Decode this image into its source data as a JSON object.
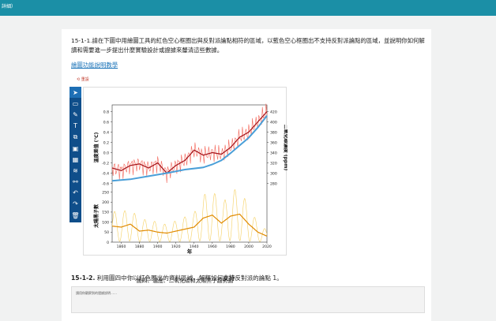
{
  "header": {
    "title": "詳細）"
  },
  "question1": {
    "number": "15-1-1.",
    "text": "請在下圖中用繪圖工具的紅色空心框圈出與反對派論點相符的區域，以藍色空心框圈出不支持反對派論點的區域，並說明你如何解讀和需要進一步提出什麼實驗設計或證據來釐清這些數據。",
    "tutorial_link": "繪圖功能說明教學",
    "undo_label": "重設"
  },
  "toolbar": {
    "tools": [
      {
        "icon": "cursor-icon",
        "glyph": "➤"
      },
      {
        "icon": "rectangle-icon",
        "glyph": "▭"
      },
      {
        "icon": "pencil-icon",
        "glyph": "✎"
      },
      {
        "icon": "text-icon",
        "glyph": "T"
      },
      {
        "icon": "image-icon",
        "glyph": "⧉"
      },
      {
        "icon": "frame-icon",
        "glyph": "▣"
      },
      {
        "icon": "color-palette-icon",
        "glyph": "▦"
      },
      {
        "icon": "layers-icon",
        "glyph": "≋"
      },
      {
        "icon": "link-icon",
        "glyph": "⚯"
      },
      {
        "icon": "undo-icon",
        "glyph": "↶"
      },
      {
        "icon": "redo-icon",
        "glyph": "↷"
      },
      {
        "icon": "delete-icon",
        "glyph": "🗑"
      }
    ]
  },
  "chart_data": {
    "type": "line",
    "caption": "圖四、溫度、二氧化碳和太陽黑子趨勢圖",
    "xlabel": "年",
    "xticks": [
      1860,
      1880,
      1900,
      1920,
      1940,
      1960,
      1980,
      2000,
      2020
    ],
    "xlim": [
      1850,
      2020
    ],
    "panels": [
      {
        "ylabel_left": "溫度差值 (℃)",
        "yticks_left": [
          0.8,
          0.6,
          0.4,
          0.2,
          0.0,
          -0.2,
          -0.4,
          -0.6
        ],
        "ylabel_right": "二氧化碳濃度 (ppm)",
        "yticks_right": [
          420,
          400,
          380,
          360,
          340,
          320,
          300,
          280
        ],
        "series": [
          {
            "color": "#d7191c",
            "x": [
              1850,
              1860,
              1870,
              1880,
              1890,
              1900,
              1910,
              1920,
              1930,
              1940,
              1950,
              1960,
              1970,
              1980,
              1990,
              2000,
              2010,
              2020
            ],
            "values": [
              -0.3,
              -0.35,
              -0.25,
              -0.22,
              -0.3,
              -0.2,
              -0.4,
              -0.25,
              -0.15,
              0.05,
              -0.05,
              0.0,
              -0.03,
              0.1,
              0.3,
              0.4,
              0.6,
              0.8
            ]
          },
          {
            "color": "#4a9fd8",
            "x": [
              1850,
              1870,
              1890,
              1910,
              1930,
              1950,
              1960,
              1970,
              1980,
              1990,
              2000,
              2010,
              2020
            ],
            "values": [
              285,
              288,
              294,
              300,
              307,
              311,
              317,
              325,
              339,
              354,
              369,
              389,
              412
            ]
          }
        ]
      },
      {
        "ylabel_left": "太陽黑子數",
        "yticks_left": [
          250,
          200,
          150,
          100,
          50,
          0
        ],
        "series": [
          {
            "color": "#e6a800",
            "x": [
              1850,
              1860,
              1870,
              1880,
              1890,
              1900,
              1910,
              1920,
              1930,
              1940,
              1950,
              1960,
              1970,
              1980,
              1990,
              2000,
              2010,
              2020
            ],
            "values": [
              80,
              75,
              90,
              55,
              60,
              50,
              45,
              55,
              65,
              75,
              120,
              135,
              95,
              130,
              140,
              90,
              50,
              30
            ]
          }
        ]
      }
    ]
  },
  "question2": {
    "number": "15-1-2.",
    "text_before": "利用圖四中你以紅色圈出的資料區域，解釋如何",
    "emphasis": "支持",
    "text_after": "反對派的論點 1。",
    "placeholder": "請用你觀察到的證據說明……"
  }
}
